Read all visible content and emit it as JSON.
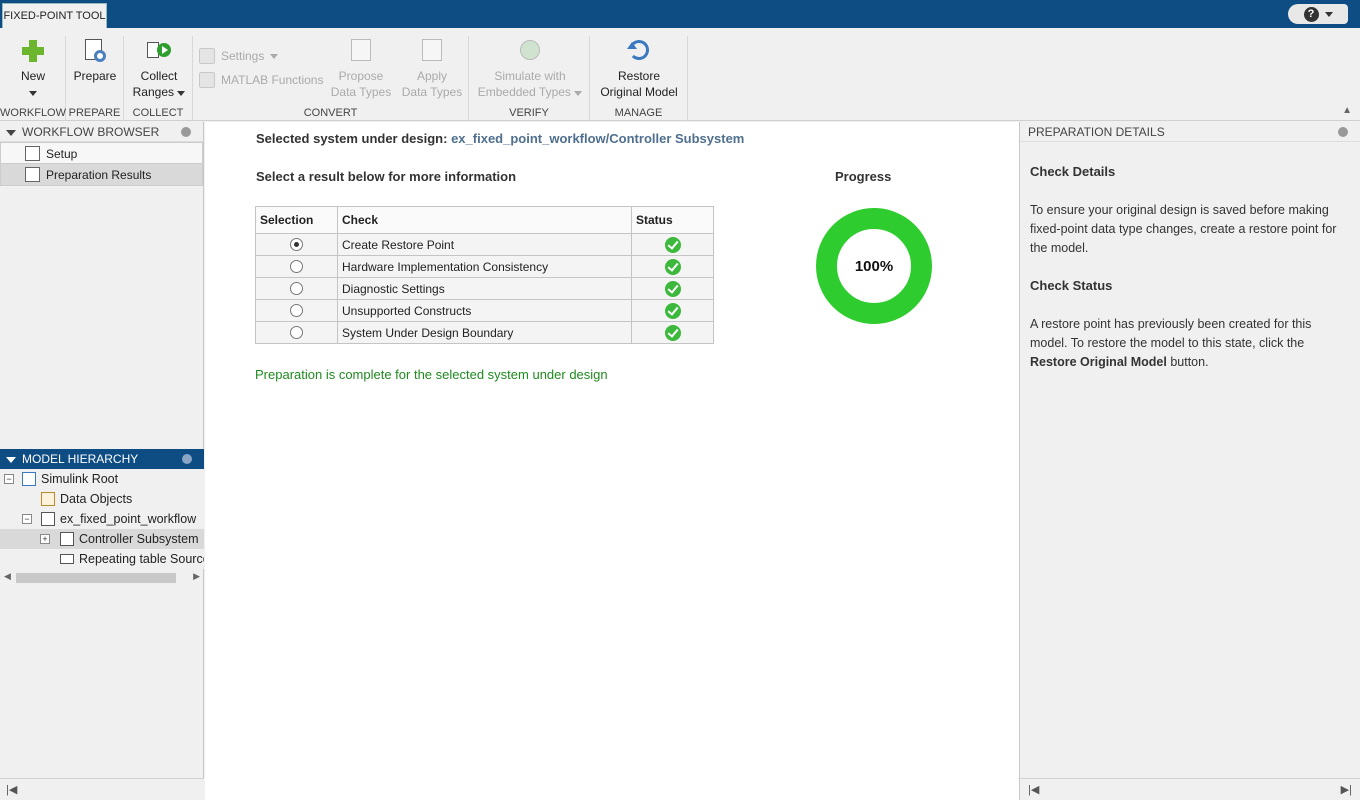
{
  "app": {
    "tab_title": "FIXED-POINT TOOL",
    "help_label": "?"
  },
  "toolstrip": {
    "sections": {
      "workflow": "WORKFLOW",
      "prepare": "PREPARE",
      "collect": "COLLECT",
      "convert": "CONVERT",
      "verify": "VERIFY",
      "manage": "MANAGE"
    },
    "new_label": "New",
    "prepare_label": "Prepare",
    "collect_line1": "Collect",
    "collect_line2": "Ranges",
    "settings_label": "Settings",
    "matlab_functions_label": "MATLAB Functions",
    "propose_line1": "Propose",
    "propose_line2": "Data Types",
    "apply_line1": "Apply",
    "apply_line2": "Data Types",
    "simulate_line1": "Simulate with",
    "simulate_line2": "Embedded Types",
    "restore_line1": "Restore",
    "restore_line2": "Original Model"
  },
  "workflow_browser": {
    "title": "WORKFLOW BROWSER",
    "items": [
      {
        "label": "Setup"
      },
      {
        "label": "Preparation Results"
      }
    ]
  },
  "model_hierarchy": {
    "title": "MODEL HIERARCHY",
    "nodes": [
      {
        "label": "Simulink Root"
      },
      {
        "label": "Data Objects"
      },
      {
        "label": "ex_fixed_point_workflow"
      },
      {
        "label": "Controller Subsystem"
      },
      {
        "label": "Repeating table Source"
      }
    ]
  },
  "main": {
    "sud_prefix": "Selected system under design:",
    "sud_path": "ex_fixed_point_workflow/Controller Subsystem",
    "instruction": "Select a result below for more information",
    "progress_title": "Progress",
    "progress_value": "100%",
    "progress_fraction": 1.0,
    "columns": [
      "Selection",
      "Check",
      "Status"
    ],
    "rows": [
      {
        "check": "Create Restore Point",
        "selected": true,
        "status": "pass"
      },
      {
        "check": "Hardware Implementation Consistency",
        "selected": false,
        "status": "pass"
      },
      {
        "check": "Diagnostic Settings",
        "selected": false,
        "status": "pass"
      },
      {
        "check": "Unsupported Constructs",
        "selected": false,
        "status": "pass"
      },
      {
        "check": "System Under Design Boundary",
        "selected": false,
        "status": "pass"
      }
    ],
    "complete_message": "Preparation is complete for the selected system under design"
  },
  "details": {
    "title": "PREPARATION DETAILS",
    "check_details_heading": "Check Details",
    "check_details_text": "To ensure your original design is saved before making fixed-point data type changes, create a restore point for the model.",
    "check_status_heading": "Check Status",
    "check_status_text_1": "A restore point has previously been created for this model. To restore the model to this state, click the",
    "check_status_bold": "Restore Original Model",
    "check_status_text_2": "button."
  },
  "colors": {
    "titlebar": "#0e4c84",
    "success": "#2ecc2e",
    "complete_text": "#1f8a1f",
    "path_text": "#4f6f8f"
  }
}
